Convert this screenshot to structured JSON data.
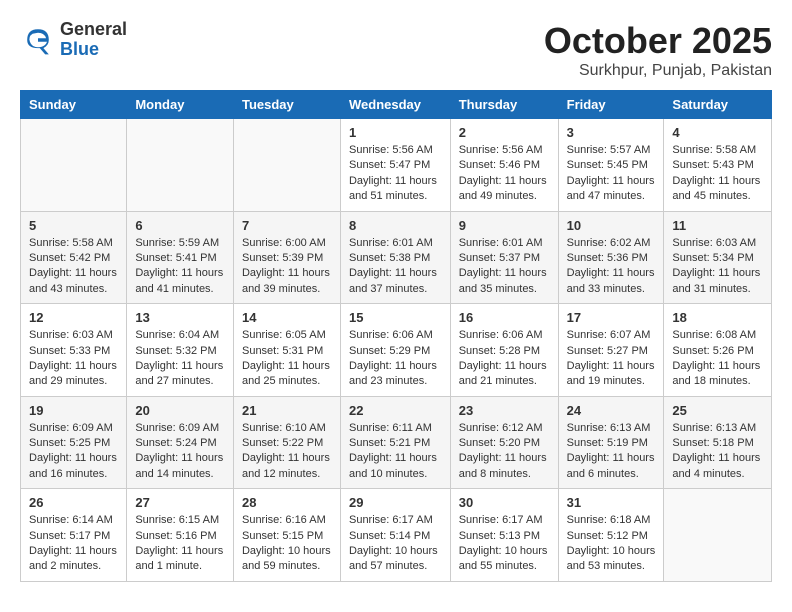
{
  "header": {
    "logo_line1": "General",
    "logo_line2": "Blue",
    "month": "October 2025",
    "location": "Surkhpur, Punjab, Pakistan"
  },
  "days_of_week": [
    "Sunday",
    "Monday",
    "Tuesday",
    "Wednesday",
    "Thursday",
    "Friday",
    "Saturday"
  ],
  "weeks": [
    [
      {
        "day": "",
        "info": ""
      },
      {
        "day": "",
        "info": ""
      },
      {
        "day": "",
        "info": ""
      },
      {
        "day": "1",
        "info": "Sunrise: 5:56 AM\nSunset: 5:47 PM\nDaylight: 11 hours\nand 51 minutes."
      },
      {
        "day": "2",
        "info": "Sunrise: 5:56 AM\nSunset: 5:46 PM\nDaylight: 11 hours\nand 49 minutes."
      },
      {
        "day": "3",
        "info": "Sunrise: 5:57 AM\nSunset: 5:45 PM\nDaylight: 11 hours\nand 47 minutes."
      },
      {
        "day": "4",
        "info": "Sunrise: 5:58 AM\nSunset: 5:43 PM\nDaylight: 11 hours\nand 45 minutes."
      }
    ],
    [
      {
        "day": "5",
        "info": "Sunrise: 5:58 AM\nSunset: 5:42 PM\nDaylight: 11 hours\nand 43 minutes."
      },
      {
        "day": "6",
        "info": "Sunrise: 5:59 AM\nSunset: 5:41 PM\nDaylight: 11 hours\nand 41 minutes."
      },
      {
        "day": "7",
        "info": "Sunrise: 6:00 AM\nSunset: 5:39 PM\nDaylight: 11 hours\nand 39 minutes."
      },
      {
        "day": "8",
        "info": "Sunrise: 6:01 AM\nSunset: 5:38 PM\nDaylight: 11 hours\nand 37 minutes."
      },
      {
        "day": "9",
        "info": "Sunrise: 6:01 AM\nSunset: 5:37 PM\nDaylight: 11 hours\nand 35 minutes."
      },
      {
        "day": "10",
        "info": "Sunrise: 6:02 AM\nSunset: 5:36 PM\nDaylight: 11 hours\nand 33 minutes."
      },
      {
        "day": "11",
        "info": "Sunrise: 6:03 AM\nSunset: 5:34 PM\nDaylight: 11 hours\nand 31 minutes."
      }
    ],
    [
      {
        "day": "12",
        "info": "Sunrise: 6:03 AM\nSunset: 5:33 PM\nDaylight: 11 hours\nand 29 minutes."
      },
      {
        "day": "13",
        "info": "Sunrise: 6:04 AM\nSunset: 5:32 PM\nDaylight: 11 hours\nand 27 minutes."
      },
      {
        "day": "14",
        "info": "Sunrise: 6:05 AM\nSunset: 5:31 PM\nDaylight: 11 hours\nand 25 minutes."
      },
      {
        "day": "15",
        "info": "Sunrise: 6:06 AM\nSunset: 5:29 PM\nDaylight: 11 hours\nand 23 minutes."
      },
      {
        "day": "16",
        "info": "Sunrise: 6:06 AM\nSunset: 5:28 PM\nDaylight: 11 hours\nand 21 minutes."
      },
      {
        "day": "17",
        "info": "Sunrise: 6:07 AM\nSunset: 5:27 PM\nDaylight: 11 hours\nand 19 minutes."
      },
      {
        "day": "18",
        "info": "Sunrise: 6:08 AM\nSunset: 5:26 PM\nDaylight: 11 hours\nand 18 minutes."
      }
    ],
    [
      {
        "day": "19",
        "info": "Sunrise: 6:09 AM\nSunset: 5:25 PM\nDaylight: 11 hours\nand 16 minutes."
      },
      {
        "day": "20",
        "info": "Sunrise: 6:09 AM\nSunset: 5:24 PM\nDaylight: 11 hours\nand 14 minutes."
      },
      {
        "day": "21",
        "info": "Sunrise: 6:10 AM\nSunset: 5:22 PM\nDaylight: 11 hours\nand 12 minutes."
      },
      {
        "day": "22",
        "info": "Sunrise: 6:11 AM\nSunset: 5:21 PM\nDaylight: 11 hours\nand 10 minutes."
      },
      {
        "day": "23",
        "info": "Sunrise: 6:12 AM\nSunset: 5:20 PM\nDaylight: 11 hours\nand 8 minutes."
      },
      {
        "day": "24",
        "info": "Sunrise: 6:13 AM\nSunset: 5:19 PM\nDaylight: 11 hours\nand 6 minutes."
      },
      {
        "day": "25",
        "info": "Sunrise: 6:13 AM\nSunset: 5:18 PM\nDaylight: 11 hours\nand 4 minutes."
      }
    ],
    [
      {
        "day": "26",
        "info": "Sunrise: 6:14 AM\nSunset: 5:17 PM\nDaylight: 11 hours\nand 2 minutes."
      },
      {
        "day": "27",
        "info": "Sunrise: 6:15 AM\nSunset: 5:16 PM\nDaylight: 11 hours\nand 1 minute."
      },
      {
        "day": "28",
        "info": "Sunrise: 6:16 AM\nSunset: 5:15 PM\nDaylight: 10 hours\nand 59 minutes."
      },
      {
        "day": "29",
        "info": "Sunrise: 6:17 AM\nSunset: 5:14 PM\nDaylight: 10 hours\nand 57 minutes."
      },
      {
        "day": "30",
        "info": "Sunrise: 6:17 AM\nSunset: 5:13 PM\nDaylight: 10 hours\nand 55 minutes."
      },
      {
        "day": "31",
        "info": "Sunrise: 6:18 AM\nSunset: 5:12 PM\nDaylight: 10 hours\nand 53 minutes."
      },
      {
        "day": "",
        "info": ""
      }
    ]
  ]
}
